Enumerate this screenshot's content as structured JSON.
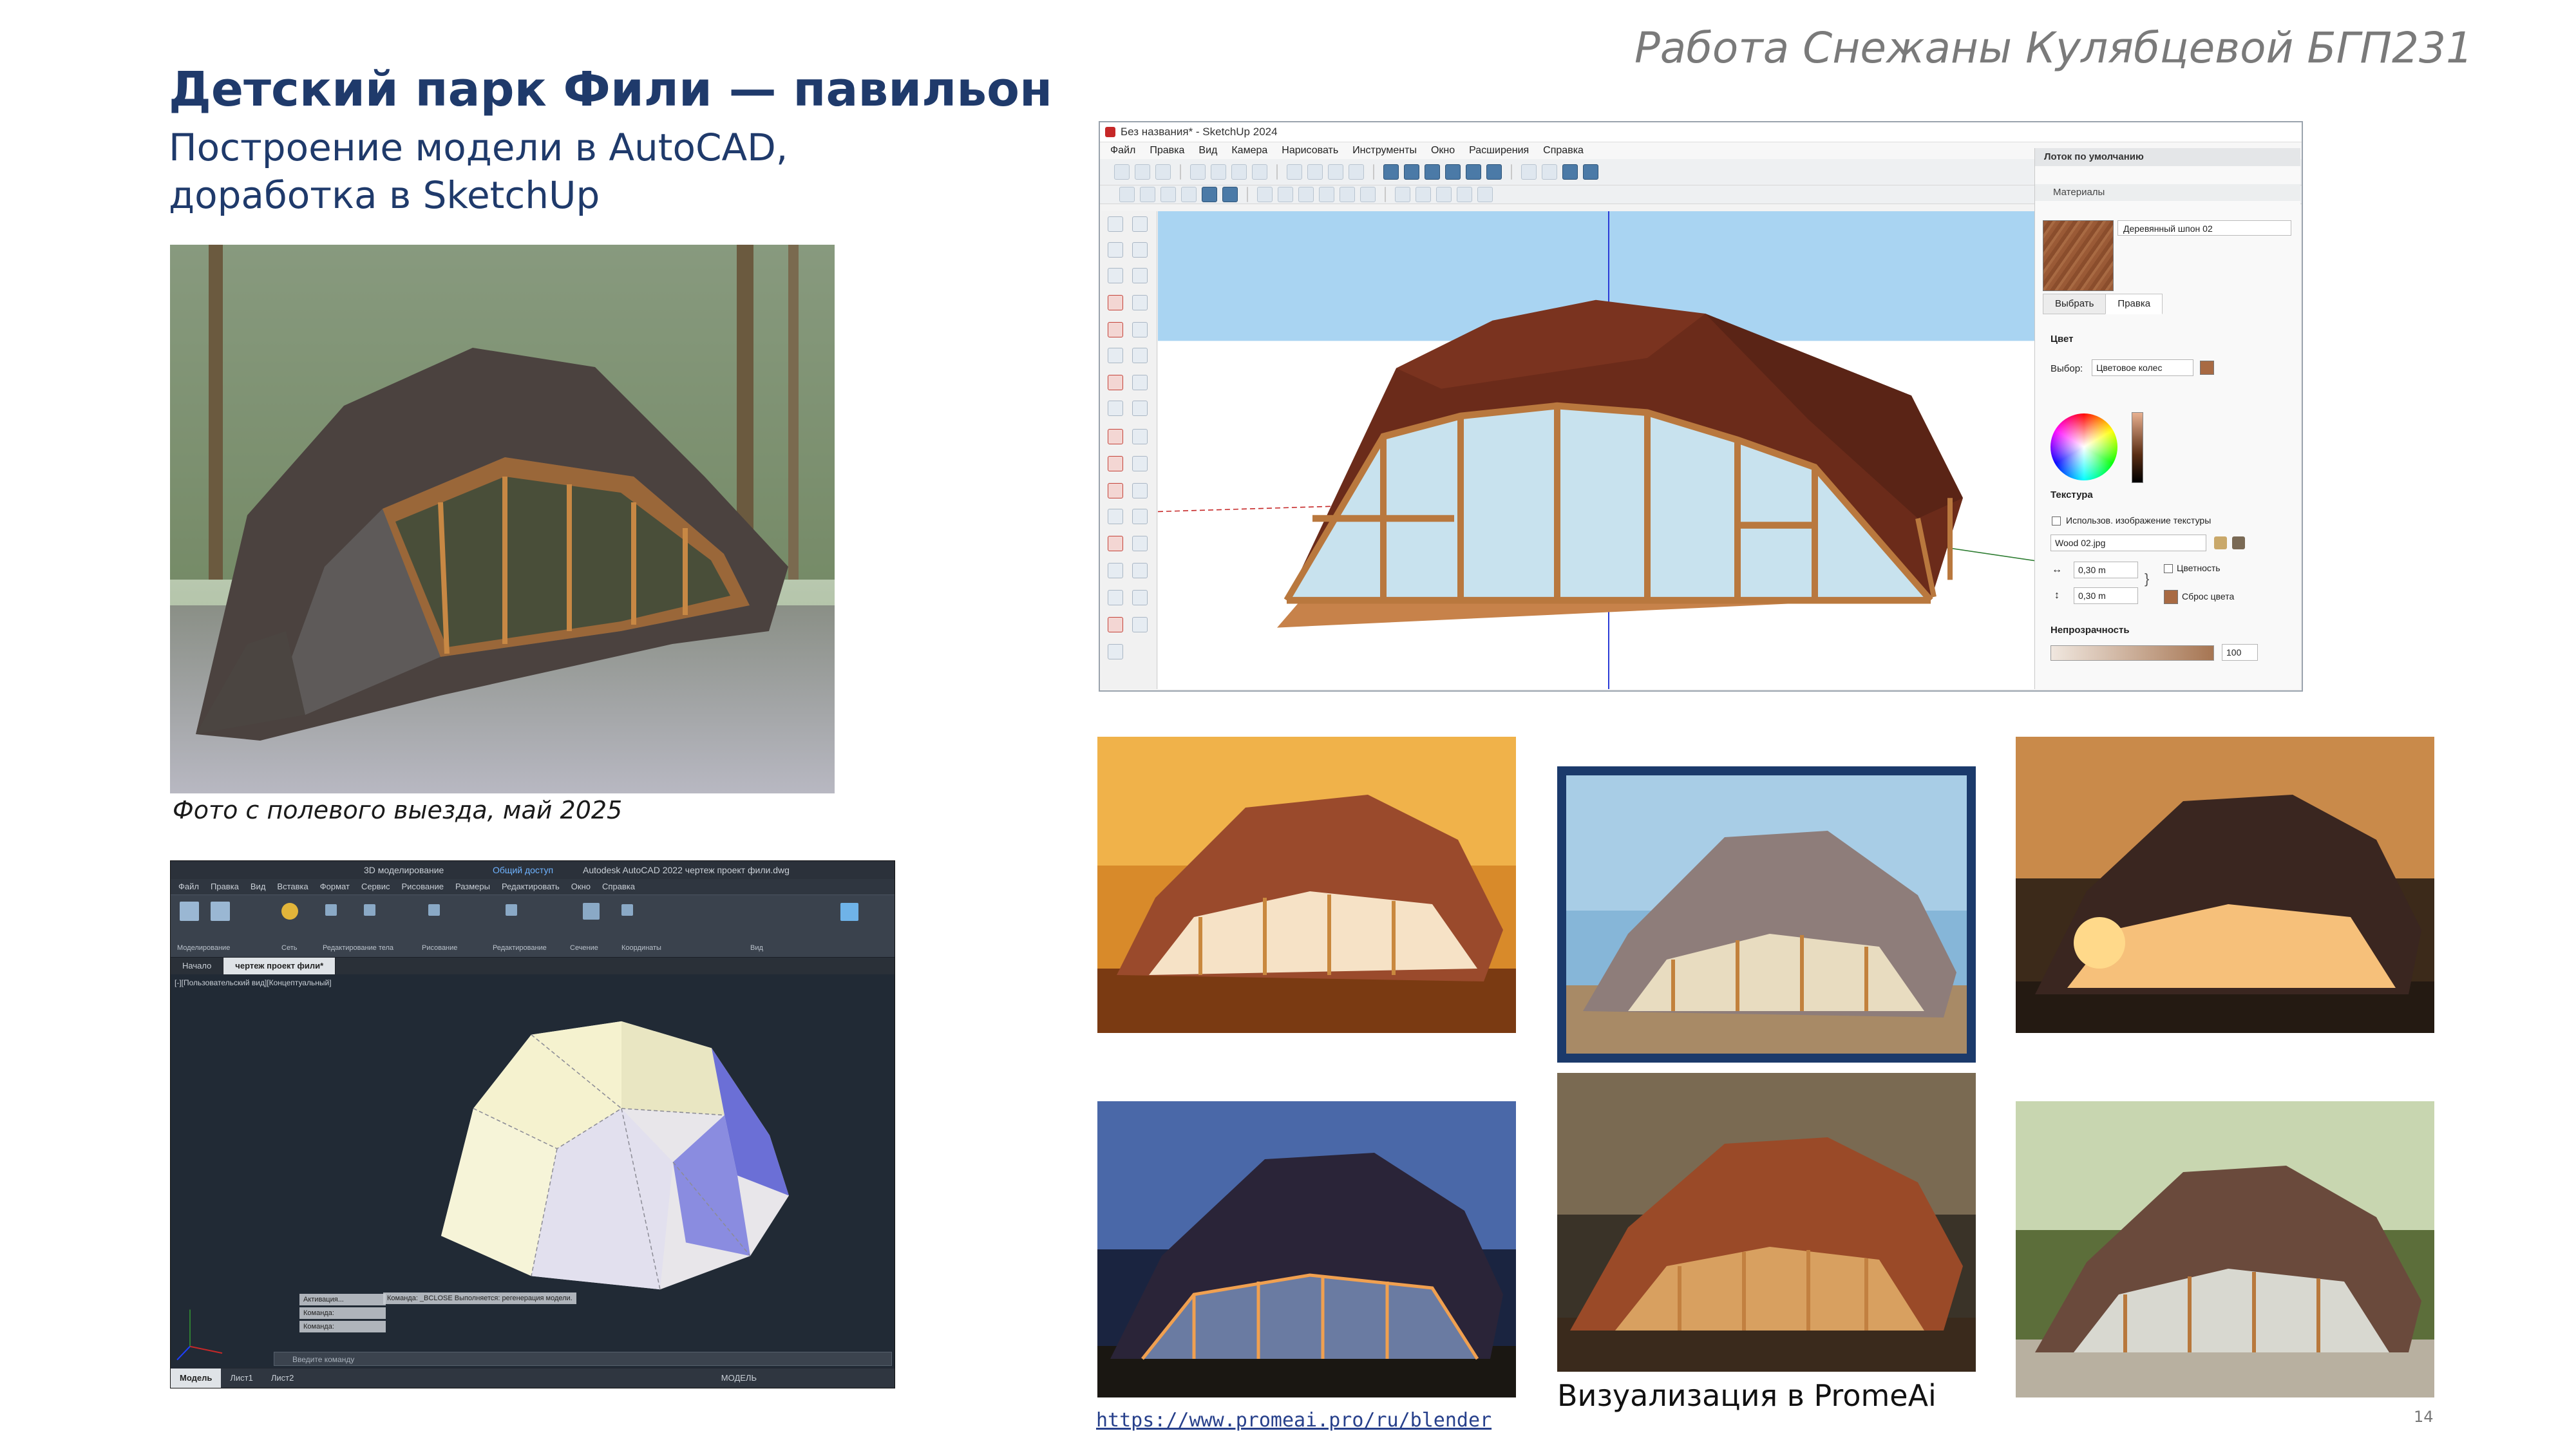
{
  "slide": {
    "author": "Работа Снежаны Кулябцевой БГП231",
    "title": "Детский парк Фили — павильон",
    "subtitle_line1": "Построение модели в AutoCAD,",
    "subtitle_line2": "доработка в SketchUp",
    "photo_caption": "Фото с полевого выезда, май 2025",
    "promeai_caption": "Визуализация в PromeAi",
    "link": "https://www.promeai.pro/ru/blender",
    "page_number": "14"
  },
  "sketchup": {
    "window_title": "Без названия* - SketchUp 2024",
    "menu": [
      "Файл",
      "Правка",
      "Вид",
      "Камера",
      "Нарисовать",
      "Инструменты",
      "Окно",
      "Расширения",
      "Справка"
    ],
    "panel": {
      "tray_title": "Лоток по умолчанию",
      "materials_label": "Материалы",
      "material_name": "Деревянный шпон 02",
      "tabs": [
        "Выбрать",
        "Правка"
      ],
      "active_tab": "Правка",
      "color_label": "Цвет",
      "picker_label": "Выбор:",
      "picker_value": "Цветовое колес",
      "texture_label": "Текстура",
      "use_texture_label": "Использов. изображение текстуры",
      "texture_file": "Wood 02.jpg",
      "width_value": "0,30 m",
      "height_value": "0,30 m",
      "colorize_label": "Цветность",
      "reset_color_label": "Сброс цвета",
      "opacity_label": "Непрозрачность",
      "opacity_value": "100"
    },
    "colors": {
      "roof": "#6b2b1a",
      "frame": "#b9783e",
      "sky": "#a9d4f2",
      "ground": "#ffffff"
    }
  },
  "autocad": {
    "title": "Autodesk AutoCAD 2022   чертеж проект фили.dwg",
    "workspace": "3D моделирование",
    "shared": "Общий доступ",
    "menu": [
      "Файл",
      "Правка",
      "Вид",
      "Вставка",
      "Формат",
      "Сервис",
      "Рисование",
      "Размеры",
      "Редактировать",
      "Окно",
      "Справка"
    ],
    "ribbon_groups": [
      "Моделирование",
      "Сеть",
      "Редактирование тела",
      "Рисование",
      "Редактирование",
      "Сечение",
      "Координаты",
      "Вид"
    ],
    "tabs": [
      "Начало",
      "чертеж проект фили*"
    ],
    "active_tab": "чертеж проект фили*",
    "viewport_label": "[-][Пользовательский вид][Концептуальный]",
    "command_history": [
      "Активация...",
      "Команда:",
      "Команда:"
    ],
    "command_long": "Команда: _BCLOSE Выполняется: регенерация модели.",
    "command_placeholder": "Введите команду",
    "status_tabs": [
      "Модель",
      "Лист1",
      "Лист2"
    ],
    "status_model": "МОДЕЛЬ"
  }
}
